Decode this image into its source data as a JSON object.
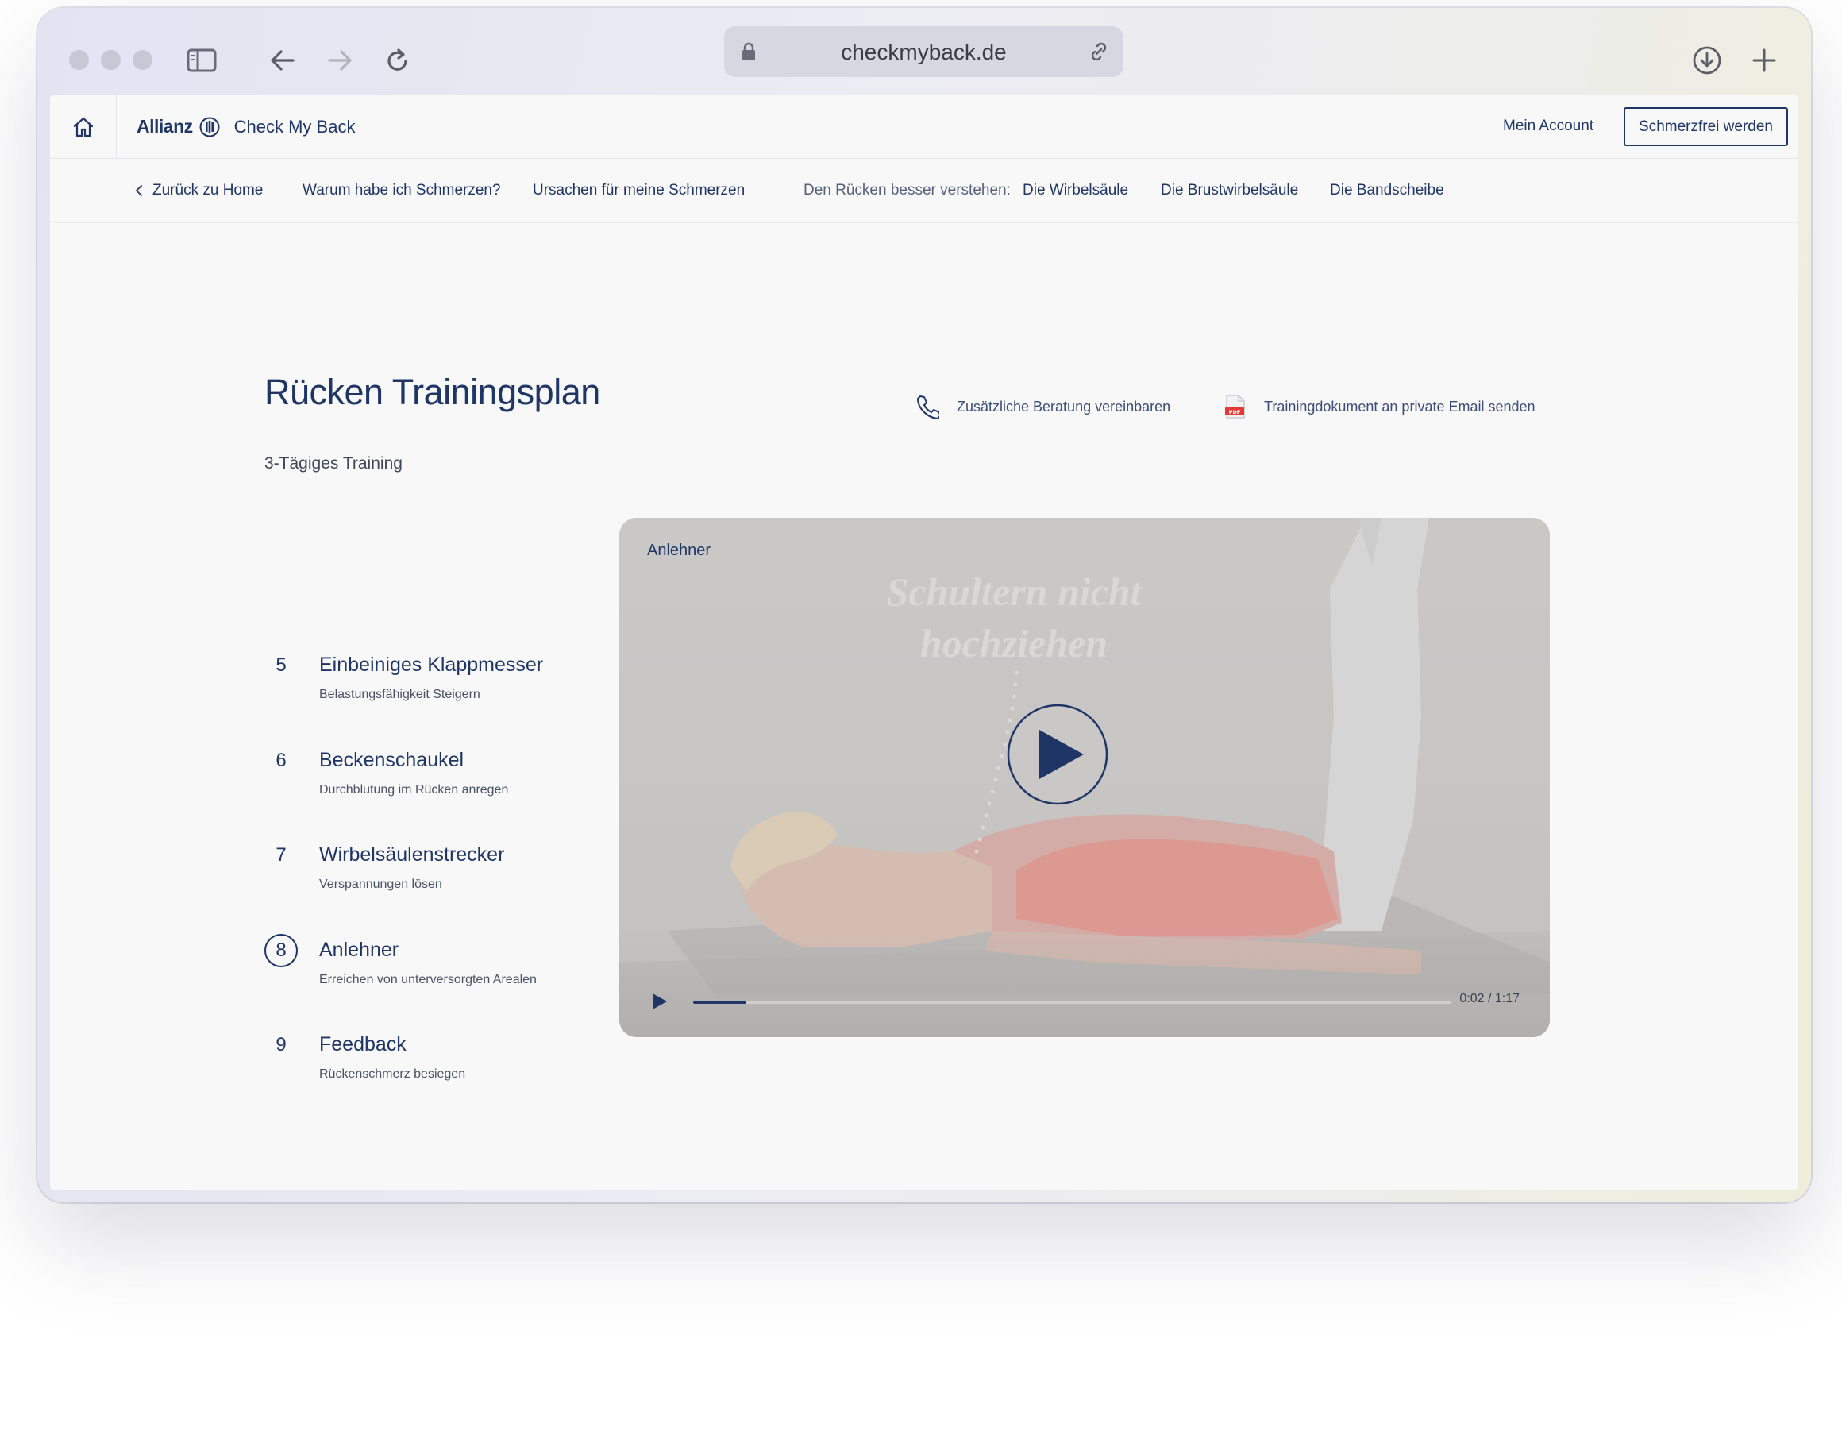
{
  "browser": {
    "url": "checkmyback.de"
  },
  "header": {
    "brand": "Allianz",
    "product": "Check My Back",
    "account_link": "Mein Account",
    "cta_button": "Schmerzfrei werden"
  },
  "subnav": {
    "back": "Zurück zu Home",
    "items": [
      "Warum habe ich Schmerzen?",
      "Ursachen für meine Schmerzen"
    ],
    "section_label": "Den Rücken besser verstehen:",
    "section_items": [
      "Die Wirbelsäule",
      "Die Brustwirbelsäule",
      "Die Bandscheibe"
    ]
  },
  "main": {
    "title": "Rücken Trainingsplan",
    "subtitle": "3-Tägiges Training",
    "actions": [
      {
        "label": "Zusätzliche Beratung vereinbaren",
        "icon": "phone-icon"
      },
      {
        "label": "Trainingdokument an private Email senden",
        "icon": "pdf-icon"
      }
    ],
    "steps": [
      {
        "number": "5",
        "title": "Einbeiniges Klappmesser",
        "description": "Belastungsfähigkeit Steigern",
        "active": false
      },
      {
        "number": "6",
        "title": "Beckenschaukel",
        "description": "Durchblutung im Rücken anregen",
        "active": false
      },
      {
        "number": "7",
        "title": "Wirbelsäulenstrecker",
        "description": "Verspannungen lösen",
        "active": false
      },
      {
        "number": "8",
        "title": "Anlehner",
        "description": "Erreichen von unterversorgten Arealen",
        "active": true
      },
      {
        "number": "9",
        "title": "Feedback",
        "description": "Rückenschmerz besiegen",
        "active": false
      }
    ],
    "video": {
      "label": "Anlehner",
      "overlay_text_line1": "Schultern nicht",
      "overlay_text_line2": "hochziehen",
      "time": "0:02 / 1:17",
      "progress": 0.07
    }
  },
  "colors": {
    "brand_navy": "#1f3566",
    "page_bg": "#f8f8f9"
  }
}
